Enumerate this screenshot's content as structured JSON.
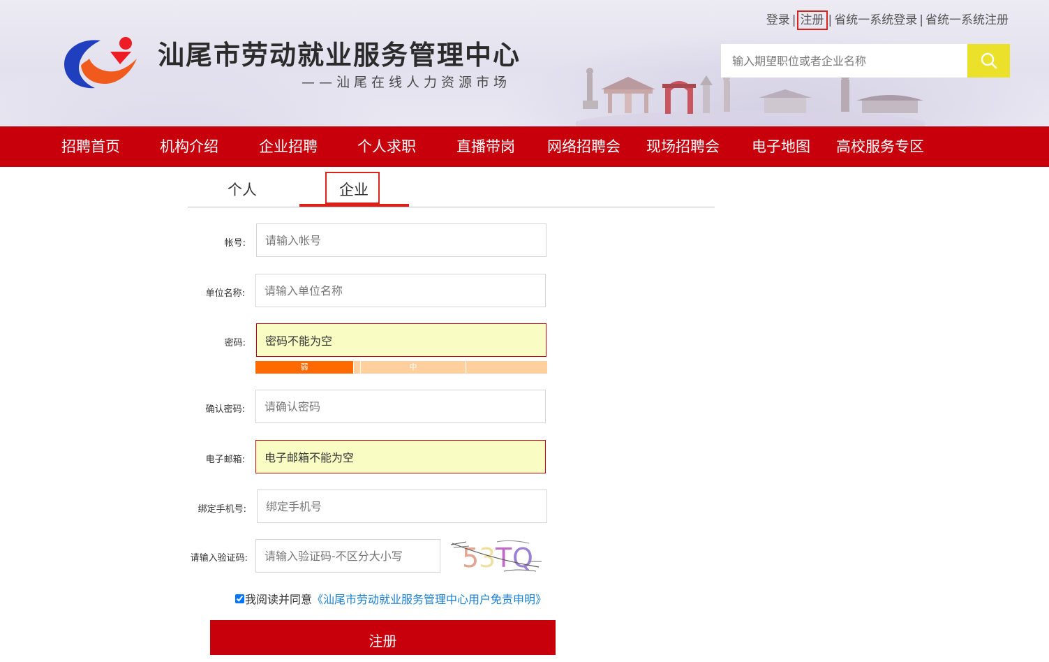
{
  "header": {
    "title": "汕尾市劳动就业服务管理中心",
    "subtitle": "——汕尾在线人力资源市场",
    "links": [
      {
        "label": "登录"
      },
      {
        "label": "注册"
      },
      {
        "label": "省统一系统登录"
      },
      {
        "label": "省统一系统注册"
      }
    ],
    "link_separator": "|",
    "search": {
      "placeholder": "输入期望职位或者企业名称",
      "icon": "search-icon"
    },
    "colors": {
      "search_button": "#ece12a"
    }
  },
  "nav": {
    "items": [
      {
        "label": "招聘首页"
      },
      {
        "label": "机构介绍"
      },
      {
        "label": "企业招聘"
      },
      {
        "label": "个人求职"
      },
      {
        "label": "直播带岗"
      },
      {
        "label": "网络招聘会"
      },
      {
        "label": "现场招聘会"
      },
      {
        "label": "电子地图"
      },
      {
        "label": "高校服务专区"
      }
    ],
    "color": "#c8000c"
  },
  "tabs": {
    "items": [
      {
        "label": "个人"
      },
      {
        "label": "企业"
      }
    ],
    "active": "企业"
  },
  "form": {
    "account": {
      "label": "帐号:",
      "placeholder": "请输入帐号",
      "value": ""
    },
    "company_name": {
      "label": "单位名称:",
      "placeholder": "请输入单位名称",
      "value": ""
    },
    "password": {
      "label": "密码:",
      "placeholder": "",
      "value": "密码不能为空",
      "state": "error"
    },
    "password_strength": {
      "levels": [
        "弱",
        "中",
        ""
      ],
      "current": "弱"
    },
    "confirm_password": {
      "label": "确认密码:",
      "placeholder": "请确认密码",
      "value": ""
    },
    "email": {
      "label": "电子邮箱:",
      "placeholder": "",
      "value": "电子邮箱不能为空",
      "state": "error"
    },
    "phone": {
      "label": "绑定手机号:",
      "placeholder": "绑定手机号",
      "value": ""
    },
    "captcha": {
      "label": "请输入验证码:",
      "placeholder": "请输入验证码-不区分大小写",
      "value": "",
      "image_text": "53TQ"
    },
    "agreement": {
      "checked": true,
      "text": "我阅读并同意",
      "link_text": "《汕尾市劳动就业服务管理中心用户免责申明》"
    },
    "submit_label": "注册"
  },
  "colors": {
    "error_bg": "#f9fdc4",
    "accent": "#c8000c",
    "link": "#1b7fd1",
    "strength_weak": "#ff6a00",
    "strength_rest": "#ffcf9e"
  }
}
